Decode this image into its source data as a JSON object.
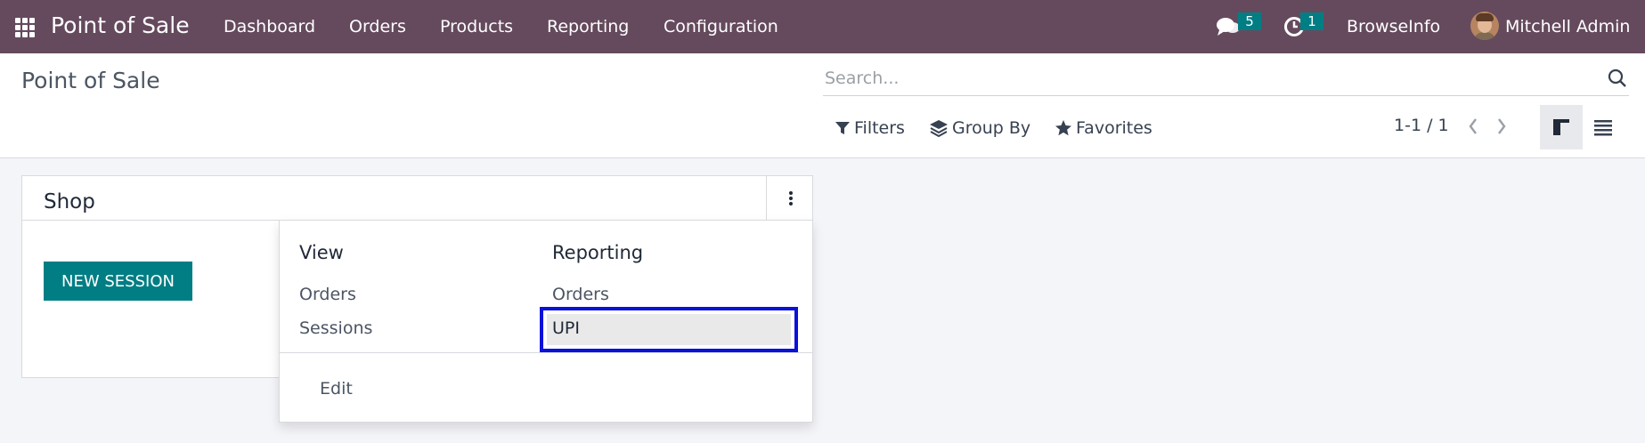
{
  "navbar": {
    "brand": "Point of Sale",
    "menu": [
      "Dashboard",
      "Orders",
      "Products",
      "Reporting",
      "Configuration"
    ],
    "messages_count": "5",
    "activities_count": "1",
    "company": "BrowseInfo",
    "user": "Mitchell Admin"
  },
  "control_panel": {
    "title": "Point of Sale",
    "search_placeholder": "Search...",
    "filters_label": "Filters",
    "group_by_label": "Group By",
    "favorites_label": "Favorites",
    "pager": "1-1 / 1"
  },
  "card": {
    "title": "Shop",
    "new_session_label": "NEW SESSION"
  },
  "dropdown": {
    "view_heading": "View",
    "view_items": [
      "Orders",
      "Sessions"
    ],
    "reporting_heading": "Reporting",
    "reporting_items": [
      "Orders",
      "UPI"
    ],
    "edit_label": "Edit"
  },
  "colors": {
    "navbar": "#654a5e",
    "primary": "#017e84",
    "highlight_border": "#0a11d8"
  }
}
